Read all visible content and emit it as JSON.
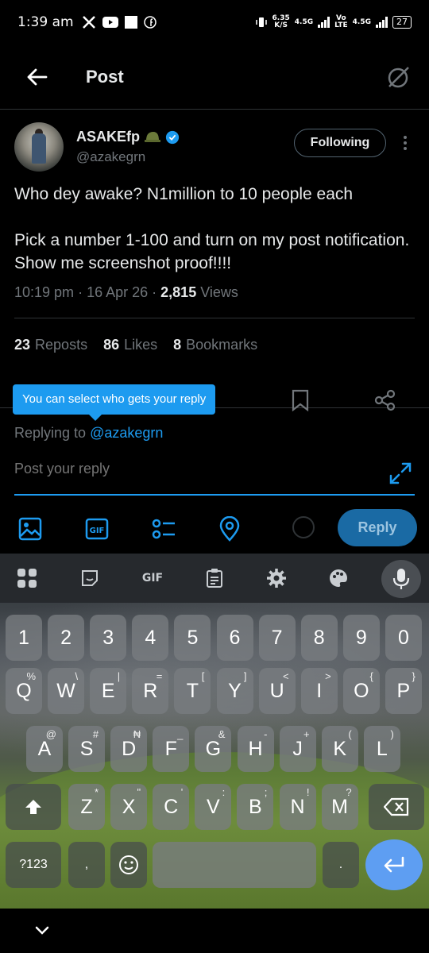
{
  "status_bar": {
    "time": "1:39 am",
    "speed_value": "6.35",
    "speed_unit": "K/S",
    "net1": "4.5G",
    "volte_top": "Vo",
    "volte_bottom": "LTE",
    "net2": "4.5G",
    "battery": "27"
  },
  "header": {
    "title": "Post"
  },
  "post": {
    "display_name": "ASAKEfp",
    "handle": "@azakegrn",
    "following_label": "Following",
    "text": "Who dey awake? N1million to 10 people each\n\nPick a number 1-100 and turn on my post notification. Show me screenshot proof!!!!",
    "time": "10:19 pm",
    "date": "16 Apr 26",
    "views_count": "2,815",
    "views_label": "Views",
    "stats": [
      {
        "count": "23",
        "label": "Reposts"
      },
      {
        "count": "86",
        "label": "Likes"
      },
      {
        "count": "8",
        "label": "Bookmarks"
      }
    ]
  },
  "reply": {
    "tooltip": "You can select who gets your reply",
    "replying_prefix": "Replying to",
    "replying_handle": "@azakegrn",
    "placeholder": "Post your reply",
    "button_label": "Reply"
  },
  "keyboard": {
    "toolbar": {
      "gif": "GIF"
    },
    "row_numbers": [
      "1",
      "2",
      "3",
      "4",
      "5",
      "6",
      "7",
      "8",
      "9",
      "0"
    ],
    "row1": [
      {
        "k": "Q",
        "s": "%"
      },
      {
        "k": "W",
        "s": "\\"
      },
      {
        "k": "E",
        "s": "|"
      },
      {
        "k": "R",
        "s": "="
      },
      {
        "k": "T",
        "s": "["
      },
      {
        "k": "Y",
        "s": "]"
      },
      {
        "k": "U",
        "s": "<"
      },
      {
        "k": "I",
        "s": ">"
      },
      {
        "k": "O",
        "s": "{"
      },
      {
        "k": "P",
        "s": "}"
      }
    ],
    "row2": [
      {
        "k": "A",
        "s": "@"
      },
      {
        "k": "S",
        "s": "#"
      },
      {
        "k": "D",
        "s": "₦"
      },
      {
        "k": "F",
        "s": "_"
      },
      {
        "k": "G",
        "s": "&"
      },
      {
        "k": "H",
        "s": "-"
      },
      {
        "k": "J",
        "s": "+"
      },
      {
        "k": "K",
        "s": "("
      },
      {
        "k": "L",
        "s": ")"
      }
    ],
    "row3": [
      {
        "k": "Z",
        "s": "*"
      },
      {
        "k": "X",
        "s": "\""
      },
      {
        "k": "C",
        "s": "'"
      },
      {
        "k": "V",
        "s": ":"
      },
      {
        "k": "B",
        "s": ";"
      },
      {
        "k": "N",
        "s": "!"
      },
      {
        "k": "M",
        "s": "?"
      }
    ],
    "symbols_label": "?123",
    "comma": ",",
    "period": "."
  },
  "colors": {
    "accent": "#1d9bf0",
    "muted": "#71767b",
    "reply_button": "#1a6aa4",
    "enter_key": "#5e9ef2"
  }
}
